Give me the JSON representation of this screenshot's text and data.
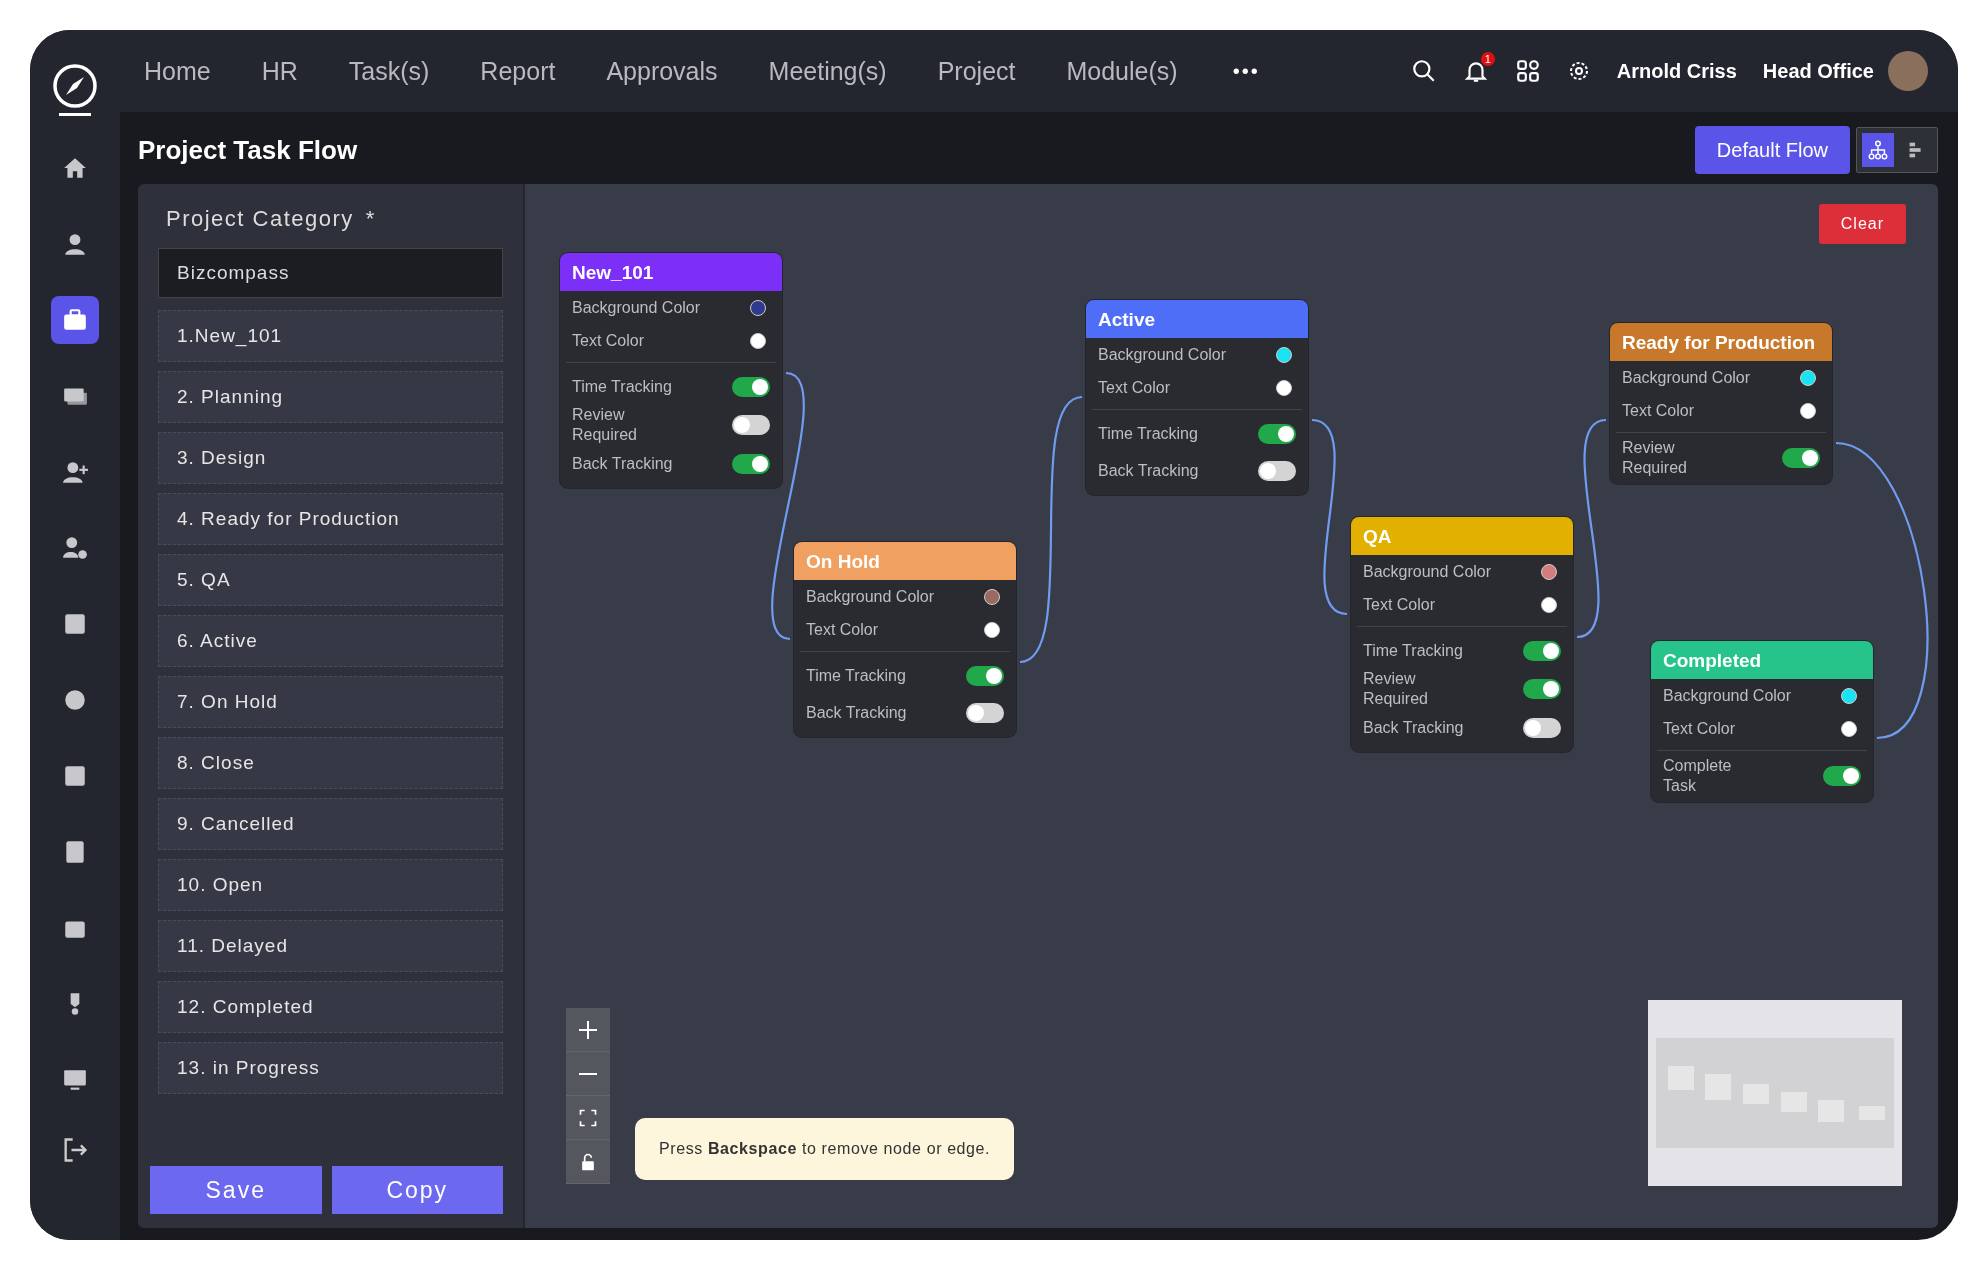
{
  "nav": {
    "items": [
      "Home",
      "HR",
      "Task(s)",
      "Report",
      "Approvals",
      "Meeting(s)",
      "Project",
      "Module(s)"
    ],
    "more": "•••",
    "notification_count": "1",
    "user_name": "Arnold Criss",
    "office": "Head Office"
  },
  "sidebar": {
    "items": [
      {
        "selected": false
      },
      {
        "selected": false
      },
      {
        "selected": true
      },
      {
        "selected": false
      },
      {
        "selected": false
      },
      {
        "selected": false
      },
      {
        "selected": false
      },
      {
        "selected": false
      },
      {
        "selected": false
      },
      {
        "selected": false
      },
      {
        "selected": false
      },
      {
        "selected": false
      },
      {
        "selected": false
      }
    ]
  },
  "page_title": "Project Task Flow",
  "default_flow_button": "Default Flow",
  "view_toggle": [
    {
      "selected": true
    },
    {
      "selected": false
    }
  ],
  "category": {
    "label": "Project Category",
    "required_mark": "*",
    "value": "Bizcompass",
    "items": [
      "1.New_101",
      "2. Planning",
      "3. Design",
      "4. Ready for Production",
      "5. QA",
      "6. Active",
      "7. On Hold",
      "8. Close",
      "9. Cancelled",
      "10. Open",
      "11. Delayed",
      "12. Completed",
      "13. in Progress"
    ]
  },
  "save_button": "Save",
  "copy_button": "Copy",
  "clear_button": "Clear",
  "nodes": [
    {
      "title": "New_101",
      "color": "#7b2ff7",
      "rows": [
        {
          "kind": "color",
          "label": "Background Color",
          "color": "#2f3a8f"
        },
        {
          "kind": "color",
          "label": "Text Color",
          "color": "#ffffff"
        },
        {
          "kind": "toggle",
          "label": "Time Tracking",
          "on": true
        },
        {
          "kind": "toggle",
          "label": "Review Required",
          "on": false
        },
        {
          "kind": "toggle",
          "label": "Back Tracking",
          "on": true
        }
      ]
    },
    {
      "title": "On Hold",
      "color": "#f0a060",
      "rows": [
        {
          "kind": "color",
          "label": "Background Color",
          "color": "#9a6a62"
        },
        {
          "kind": "color",
          "label": "Text Color",
          "color": "#ffffff"
        },
        {
          "kind": "toggle",
          "label": "Time Tracking",
          "on": true
        },
        {
          "kind": "toggle",
          "label": "Back Tracking",
          "on": false
        }
      ]
    },
    {
      "title": "Active",
      "color": "#4f6ef7",
      "rows": [
        {
          "kind": "color",
          "label": "Background Color",
          "color": "#19e3f2"
        },
        {
          "kind": "color",
          "label": "Text Color",
          "color": "#ffffff"
        },
        {
          "kind": "toggle",
          "label": "Time Tracking",
          "on": true
        },
        {
          "kind": "toggle",
          "label": "Back Tracking",
          "on": false
        }
      ]
    },
    {
      "title": "QA",
      "color": "#e2b000",
      "rows": [
        {
          "kind": "color",
          "label": "Background Color",
          "color": "#d37d7d"
        },
        {
          "kind": "color",
          "label": "Text Color",
          "color": "#ffffff"
        },
        {
          "kind": "toggle",
          "label": "Time Tracking",
          "on": true
        },
        {
          "kind": "toggle",
          "label": "Review Required",
          "on": true
        },
        {
          "kind": "toggle",
          "label": "Back Tracking",
          "on": false
        }
      ]
    },
    {
      "title": "Ready for Production",
      "color": "#c8782a",
      "rows": [
        {
          "kind": "color",
          "label": "Background Color",
          "color": "#19e3f2"
        },
        {
          "kind": "color",
          "label": "Text Color",
          "color": "#ffffff"
        },
        {
          "kind": "toggle",
          "label": "Review Required",
          "on": true
        }
      ]
    },
    {
      "title": "Completed",
      "color": "#26c48a",
      "rows": [
        {
          "kind": "color",
          "label": "Background Color",
          "color": "#19e3f2"
        },
        {
          "kind": "color",
          "label": "Text Color",
          "color": "#ffffff"
        },
        {
          "kind": "toggle",
          "label": "Complete Task",
          "on": true
        }
      ]
    }
  ],
  "hint": "Press **Backspace** to remove node or edge."
}
